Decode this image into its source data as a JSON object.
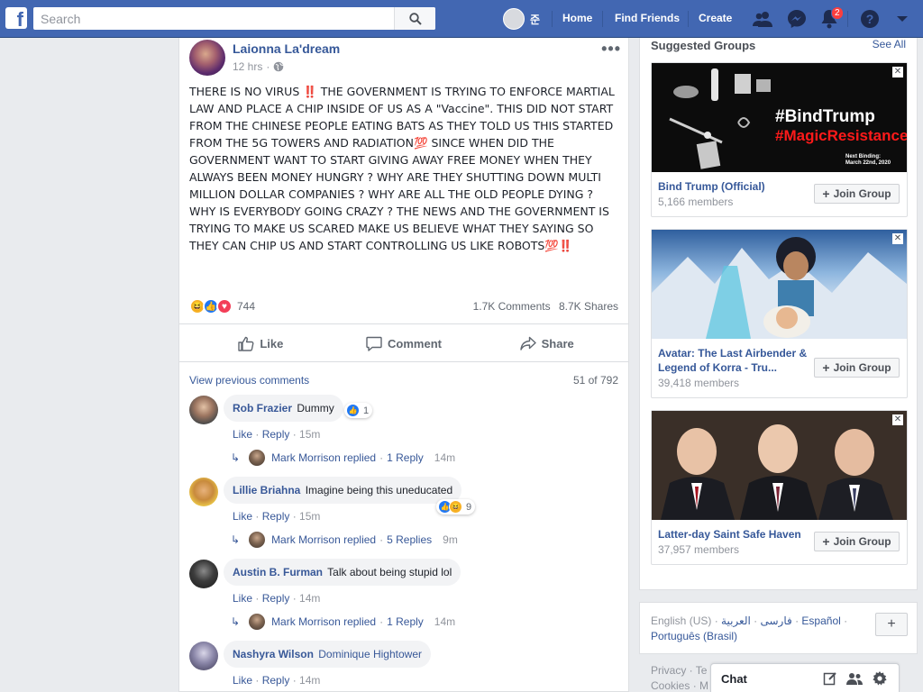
{
  "topbar": {
    "logo": "f",
    "search_placeholder": "Search",
    "user_name": "준",
    "nav": [
      "Home",
      "Find Friends",
      "Create"
    ],
    "notification_count": "2",
    "icons": [
      "friend-requests-icon",
      "messenger-icon",
      "notifications-icon",
      "help-icon",
      "account-menu-icon"
    ]
  },
  "post": {
    "author": "Laionna La'dream",
    "time": "12 hrs",
    "separator": "·",
    "privacy_icon": "globe-icon",
    "text": "THERE IS NO VIRUS ‼️ THE ￼￼￼GOVERNMENT IS TRYING TO ENFORCE MARTIAL LAW AND PLACE A CHIP INSIDE OF US AS A \"Vaccine\". THIS DID NOT START FROM THE CHINESE PEOPLE EATING BATS AS THEY TOLD US THIS STARTED FROM THE 5G TOWERS AND RADIATION💯 SINCE WHEN DID THE GOVERNMENT WANT TO START GIVING AWAY FREE MONEY WHEN THEY ALWAYS BEEN MONEY HUNGRY ? WHY ARE THEY SHUTTING DOWN ￼￼MULTI MILLION DOLLAR COMPANIES ? WHY ARE ALL THE OLD PEOPLE DYING ? WHY IS EVERYBODY GOING CRAZY ? THE NEWS AND THE GOVERNMENT IS TRYING TO MAKE US SCARED MAKE US BELIEVE WHAT THEY SAYING SO THEY CAN CHIP US AND START CONTROLLING US LIKE ROBOTS💯‼️",
    "reaction_count": "744",
    "comments_count": "1.7K Comments",
    "shares_count": "8.7K Shares",
    "actions": {
      "like": "Like",
      "comment": "Comment",
      "share": "Share"
    },
    "view_previous": "View previous comments",
    "comment_position": "51 of 792"
  },
  "comments": [
    {
      "author": "Rob Frazier",
      "text": "Dummy",
      "reactions": "1",
      "like": "Like",
      "reply": "Reply",
      "time": "15m",
      "reply_summary": {
        "who": "Mark Morrison replied",
        "count": "1 Reply",
        "time": "14m"
      }
    },
    {
      "author": "Lillie Briahna",
      "text": "Imagine being this uneducated",
      "reactions": "9",
      "like": "Like",
      "reply": "Reply",
      "time": "15m",
      "reply_summary": {
        "who": "Mark Morrison replied",
        "count": "5 Replies",
        "time": "9m"
      }
    },
    {
      "author": "Austin B. Furman",
      "text": "Talk about being stupid lol",
      "like": "Like",
      "reply": "Reply",
      "time": "14m",
      "reply_summary": {
        "who": "Mark Morrison replied",
        "count": "1 Reply",
        "time": "14m"
      }
    },
    {
      "author": "Nashyra Wilson",
      "text": "Dominique Hightower",
      "like": "Like",
      "reply": "Reply",
      "time": "14m"
    }
  ],
  "suggested_groups": {
    "title": "Suggested Groups",
    "see_all": "See All",
    "join_label": "Join Group",
    "items": [
      {
        "name": "Bind Trump (Official)",
        "members": "5,166 members",
        "image_line1": "#BindTrump",
        "image_line2": "#MagicResistance",
        "image_caption_1": "Next Binding:",
        "image_caption_2": "March 22nd, 2020"
      },
      {
        "name": "Avatar: The Last Airbender & Legend of Korra - Tru...",
        "members": "39,418 members"
      },
      {
        "name": "Latter-day Saint Safe Haven",
        "members": "37,957 members"
      }
    ]
  },
  "languages": {
    "current": "English (US)",
    "others": [
      "فارسی",
      "العربية",
      "Español",
      "Português (Brasil)"
    ],
    "add_label": "+"
  },
  "footer": {
    "line1": "Privacy · Te",
    "line2": "Cookies · M"
  },
  "chat": {
    "label": "Chat"
  }
}
